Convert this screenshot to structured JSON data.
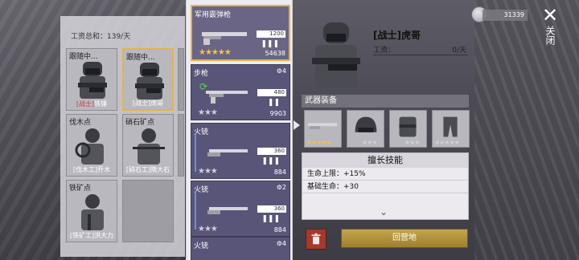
{
  "header": {
    "wage_total": "工资总和：139/天"
  },
  "currency": {
    "amount": "31339",
    "icon": "coin-icon"
  },
  "close": {
    "label": "关闭"
  },
  "workers": [
    {
      "title": "跟随中...",
      "name": "铁锤",
      "name_prefix": "[战士]"
    },
    {
      "title": "跟随中...",
      "name": "[战士]虎哥"
    },
    {
      "title": "伐木点",
      "name": "[伐木工]乔木"
    },
    {
      "title": "硝石矿点",
      "name": "[硝石工]隋大石"
    },
    {
      "title": "铁矿点",
      "name": "[铁矿工]洪大力"
    }
  ],
  "weapons": [
    {
      "name": "军用霰弹枪",
      "stars": 5,
      "max_stars": 5,
      "ammo": "1200",
      "damage": "54638",
      "slot": ""
    },
    {
      "name": "步枪",
      "stars": 3,
      "max_stars": 3,
      "ammo": "480",
      "damage": "9903",
      "slot": "4"
    },
    {
      "name": "火铳",
      "stars": 3,
      "max_stars": 3,
      "ammo": "360",
      "damage": "884",
      "slot": ""
    },
    {
      "name": "火铳",
      "stars": 3,
      "max_stars": 3,
      "ammo": "360",
      "damage": "884",
      "slot": "2"
    },
    {
      "name": "火铳",
      "stars": 0,
      "max_stars": 0,
      "ammo": "",
      "damage": "",
      "slot": "4"
    }
  ],
  "detail": {
    "title": "[战士]虎哥",
    "wage_label": "工资：",
    "wage_value": "0/天",
    "equip_header": "武器装备",
    "skills_header": "擅长技能",
    "skills": [
      {
        "text": "生命上限：+15%"
      },
      {
        "text": "基础生命：+30"
      }
    ],
    "return_button": "回营地"
  }
}
